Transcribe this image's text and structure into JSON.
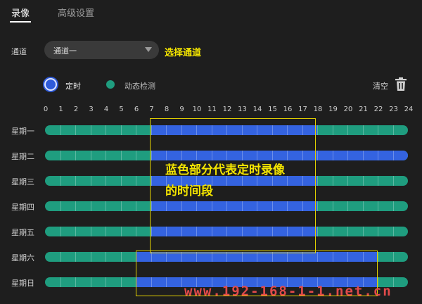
{
  "tabs": [
    {
      "label": "录像",
      "active": true
    },
    {
      "label": "高级设置",
      "active": false
    }
  ],
  "channel": {
    "label": "通道",
    "selected": "通道一",
    "annotation": "选择通道"
  },
  "legend": {
    "timed": {
      "label": "定时",
      "color": "#3463e0"
    },
    "motion": {
      "label": "动态检测",
      "color": "#1f9d7f"
    }
  },
  "clear_label": "清空",
  "hours": [
    "0",
    "1",
    "2",
    "3",
    "4",
    "5",
    "6",
    "7",
    "8",
    "9",
    "10",
    "11",
    "12",
    "13",
    "14",
    "15",
    "16",
    "17",
    "18",
    "19",
    "20",
    "21",
    "22",
    "23",
    "24"
  ],
  "schedule": [
    {
      "day": "星期一",
      "timed": [
        7,
        18
      ]
    },
    {
      "day": "星期二",
      "timed": [
        7,
        24
      ]
    },
    {
      "day": "星期三",
      "timed": [
        7,
        18
      ]
    },
    {
      "day": "星期四",
      "timed": [
        7,
        18
      ]
    },
    {
      "day": "星期五",
      "timed": [
        7,
        18
      ]
    },
    {
      "day": "星期六",
      "timed": [
        6,
        22
      ]
    },
    {
      "day": "星期日",
      "timed": [
        6,
        22
      ]
    }
  ],
  "overlay_annotation": {
    "line1": "蓝色部分代表定时录像",
    "line2": "的时间段"
  },
  "watermark": "www.192-168-1-1.net.cn"
}
